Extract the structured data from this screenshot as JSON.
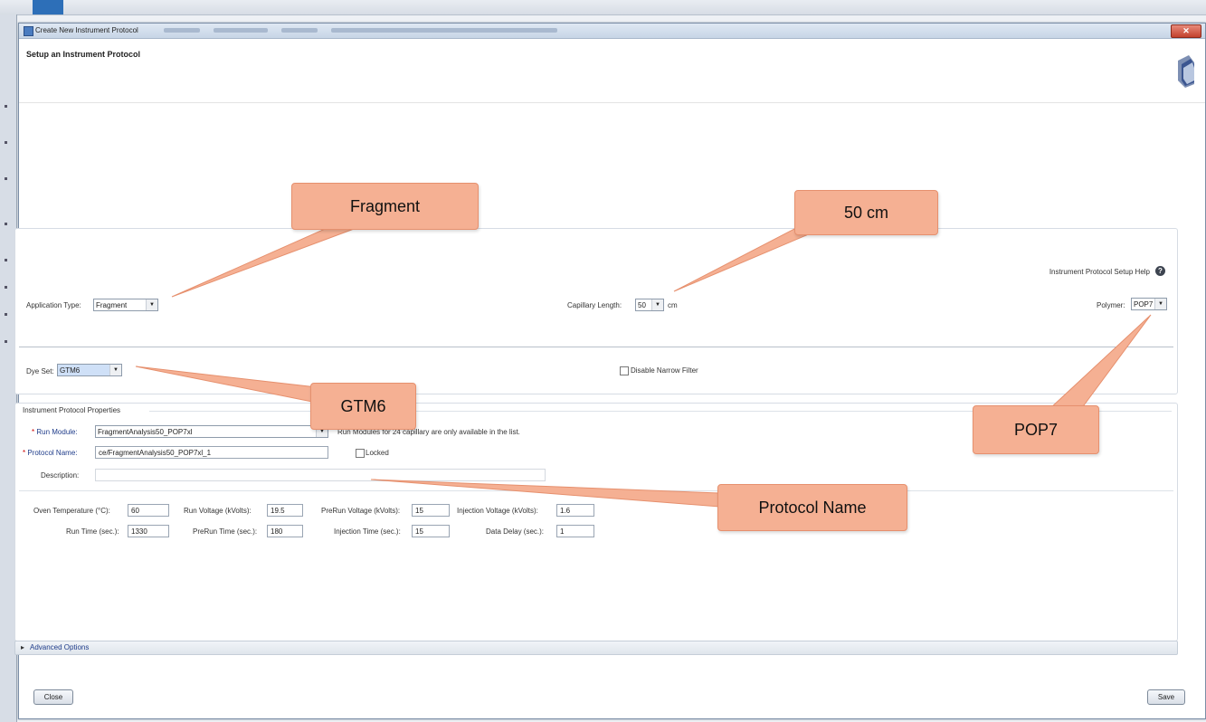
{
  "window": {
    "title": "Create New Instrument Protocol",
    "page_title": "Setup an Instrument Protocol",
    "close_glyph": "✕"
  },
  "settings": {
    "help_link": "Instrument Protocol Setup Help",
    "application_type": {
      "label": "Application Type:",
      "value": "Fragment"
    },
    "capillary_length": {
      "label": "Capillary Length:",
      "value": "50",
      "unit": "cm"
    },
    "polymer": {
      "label": "Polymer:",
      "value": "POP7"
    },
    "dye_set": {
      "label": "Dye Set:",
      "value": "GTM6"
    },
    "disable_narrow_filter": {
      "label": "Disable Narrow Filter",
      "checked": false
    }
  },
  "properties": {
    "section_title": "Instrument Protocol Properties",
    "run_module": {
      "label": "Run Module:",
      "value": "FragmentAnalysis50_POP7xl",
      "note": "Run Modules for 24 capillary are only available in the list."
    },
    "protocol_name": {
      "label": "Protocol Name:",
      "value": "ce/FragmentAnalysis50_POP7xl_1"
    },
    "locked": {
      "label": "Locked",
      "checked": false
    },
    "description": {
      "label": "Description:",
      "value": ""
    },
    "required_marker": "*"
  },
  "params": {
    "oven_temp": {
      "label": "Oven Temperature (°C):",
      "value": "60"
    },
    "run_voltage": {
      "label": "Run Voltage (kVolts):",
      "value": "19.5"
    },
    "prerun_voltage": {
      "label": "PreRun Voltage (kVolts):",
      "value": "15"
    },
    "injection_voltage": {
      "label": "Injection Voltage (kVolts):",
      "value": "1.6"
    },
    "run_time": {
      "label": "Run Time (sec.):",
      "value": "1330"
    },
    "prerun_time": {
      "label": "PreRun Time (sec.):",
      "value": "180"
    },
    "injection_time": {
      "label": "Injection Time (sec.):",
      "value": "15"
    },
    "data_delay": {
      "label": "Data Delay (sec.):",
      "value": "1"
    }
  },
  "advanced": {
    "label": "Advanced Options",
    "chevron": "▸"
  },
  "buttons": {
    "close": "Close",
    "save": "Save"
  },
  "callouts": {
    "fragment": "Fragment",
    "length": "50 cm",
    "gtm6": "GTM6",
    "pop7": "POP7",
    "protocol_name": "Protocol Name"
  },
  "colors": {
    "callout_fill": "#f5b093",
    "callout_border": "#e6906e",
    "accent": "#2d6fb8"
  }
}
